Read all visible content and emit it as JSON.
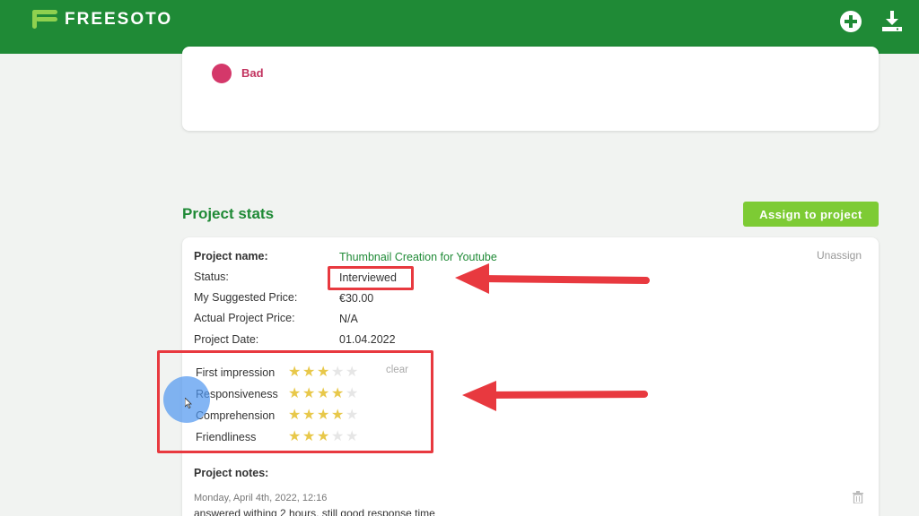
{
  "header": {
    "brand": "FREESOTO",
    "add_icon": "plus-circle-icon",
    "download_icon": "download-icon",
    "background": "#1f8a36"
  },
  "feedback_card": {
    "bad_label": "Bad",
    "bad_color": "#d4386a"
  },
  "project_stats": {
    "title": "Project stats",
    "assign_button": "Assign to project",
    "unassign_label": "Unassign",
    "fields": {
      "name_label": "Project name:",
      "name_value": "Thumbnail Creation for Youtube",
      "status_label": "Status:",
      "status_value": "Interviewed",
      "suggested_label": "My Suggested Price:",
      "suggested_value": "€30.00",
      "actual_label": "Actual Project Price:",
      "actual_value": "N/A",
      "date_label": "Project Date:",
      "date_value": "01.04.2022"
    },
    "ratings": [
      {
        "label": "First impression",
        "stars": 3,
        "max": 5
      },
      {
        "label": "Responsiveness",
        "stars": 4,
        "max": 5
      },
      {
        "label": "Comprehension",
        "stars": 4,
        "max": 5
      },
      {
        "label": "Friendliness",
        "stars": 3,
        "max": 5
      }
    ],
    "clear_label": "clear",
    "notes_title": "Project notes:",
    "note": {
      "date": "Monday, April 4th, 2022, 12:16",
      "text": "answered withing 2 hours, still good response time"
    }
  },
  "annotations": {
    "highlight_color": "#e8393f"
  }
}
